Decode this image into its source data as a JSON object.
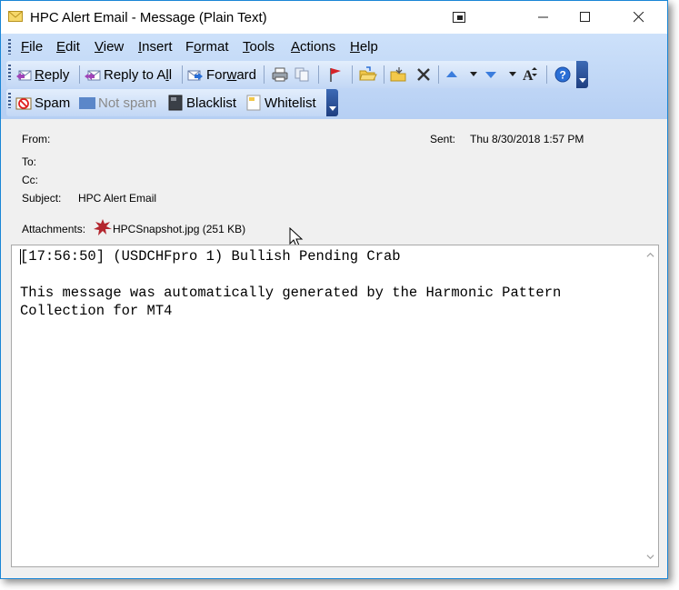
{
  "window": {
    "title": "HPC Alert Email - Message (Plain Text)"
  },
  "menu": [
    {
      "label": "File",
      "u": "F",
      "rest": "ile"
    },
    {
      "label": "Edit",
      "u": "E",
      "rest": "dit"
    },
    {
      "label": "View",
      "u": "V",
      "rest": "iew"
    },
    {
      "label": "Insert",
      "u": "I",
      "rest": "nsert"
    },
    {
      "label": "Format",
      "pre": "F",
      "u": "o",
      "rest": "rmat"
    },
    {
      "label": "Tools",
      "u": "T",
      "rest": "ools"
    },
    {
      "label": "Actions",
      "u": "A",
      "rest": "ctions"
    },
    {
      "label": "Help",
      "u": "H",
      "rest": "elp"
    }
  ],
  "toolbar": {
    "reply_pre": "",
    "reply_u": "R",
    "reply_rest": "eply",
    "replyall_pre": "Reply to A",
    "replyall_u": "l",
    "replyall_rest": "l",
    "forward_pre": "For",
    "forward_u": "w",
    "forward_rest": "ard"
  },
  "spambar": {
    "spam": "Spam",
    "not_spam": "Not spam",
    "blacklist": "Blacklist",
    "whitelist": "Whitelist"
  },
  "header": {
    "from_label": "From:",
    "to_label": "To:",
    "cc_label": "Cc:",
    "subject_label": "Subject:",
    "subject_value": "HPC Alert Email",
    "sent_label": "Sent:",
    "sent_value": "Thu 8/30/2018 1:57 PM",
    "attachments_label": "Attachments:",
    "attachment_name": "HPCSnapshot.jpg (251 KB)"
  },
  "body": {
    "line1": "[17:56:50] (USDCHFpro 1) Bullish Pending Crab",
    "line2": "",
    "line3": "This message was automatically generated by the Harmonic Pattern",
    "line4": "Collection for MT4"
  },
  "colors": {
    "accent": "#1a86d6",
    "bar": "#c2d7f5",
    "chevron": "#1f3f80"
  }
}
